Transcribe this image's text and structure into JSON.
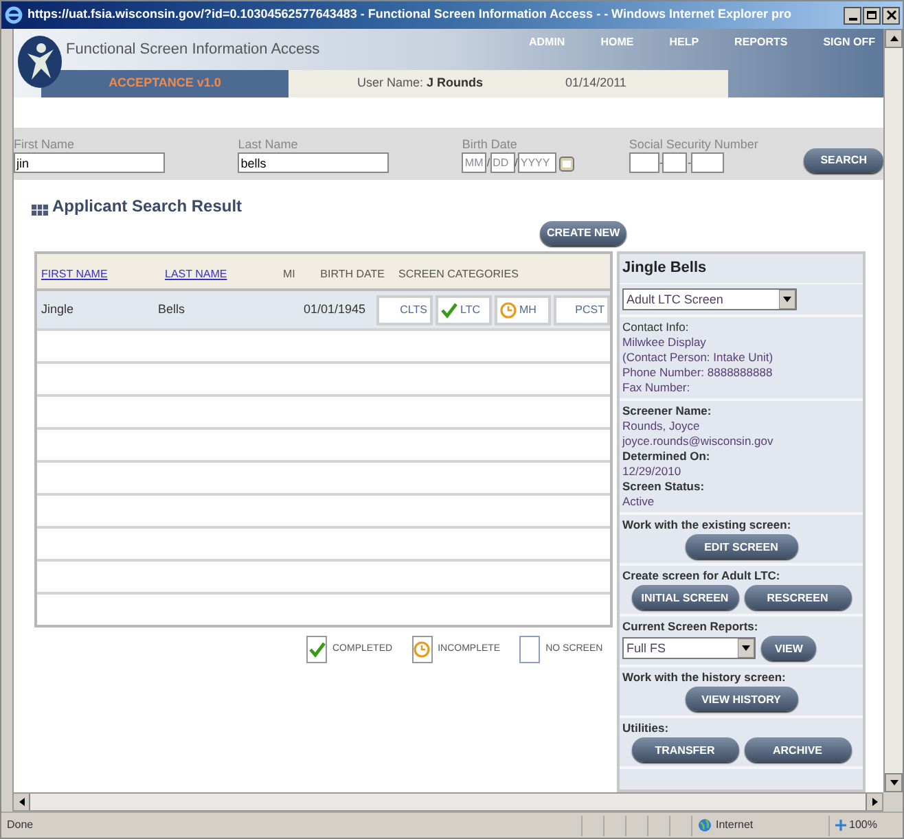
{
  "window": {
    "title": "https://uat.fsia.wisconsin.gov/?id=0.10304562577643483 - Functional Screen Information Access - - Windows Internet Explorer pro"
  },
  "header": {
    "app_title": "Functional Screen Information Access",
    "nav": [
      "ADMIN",
      "HOME",
      "HELP",
      "REPORTS",
      "SIGN OFF"
    ],
    "environment": "ACCEPTANCE v1.0",
    "user_label": "User Name:",
    "user_name": "J Rounds",
    "date": "01/14/2011"
  },
  "search": {
    "fields": [
      {
        "label": "First Name",
        "value": "jin"
      },
      {
        "label": "Last Name",
        "value": "bells"
      }
    ],
    "birth_date": {
      "label": "Birth Date",
      "placeholders": [
        "MM",
        "DD",
        "YYYY"
      ],
      "separator": "/"
    },
    "ssn": {
      "label": "Social Security Number",
      "separator": "-"
    },
    "button": "SEARCH"
  },
  "results": {
    "title": "Applicant Search Result",
    "create_button": "CREATE NEW",
    "columns": [
      {
        "label": "FIRST NAME",
        "kind": "link"
      },
      {
        "label": "LAST NAME",
        "kind": "link"
      },
      {
        "label": "MI",
        "kind": "plain"
      },
      {
        "label": "BIRTH DATE",
        "kind": "plain"
      },
      {
        "label": "SCREEN CATEGORIES",
        "kind": "plain"
      }
    ],
    "rows": [
      {
        "first_name": "Jingle",
        "last_name": "Bells",
        "birth_date": "01/01/1945",
        "selected": true,
        "categories": [
          {
            "label": "CLTS",
            "kind": "none"
          },
          {
            "label": "LTC",
            "kind": "completed"
          },
          {
            "label": "MH",
            "kind": "incomplete"
          },
          {
            "label": "PCST",
            "kind": "none"
          }
        ]
      }
    ]
  },
  "legend": [
    {
      "label": "COMPLETED",
      "kind": "completed"
    },
    {
      "label": "INCOMPLETE",
      "kind": "incomplete"
    },
    {
      "label": "NO SCREEN",
      "kind": "none"
    }
  ],
  "detail": {
    "name": "Jingle Bells",
    "screen_select": "Adult LTC Screen",
    "contact": {
      "label": "Contact Info:",
      "lines": [
        "Milwkee Display",
        "(Contact Person: Intake Unit)",
        "Phone Number: 8888888888",
        "Fax Number:"
      ]
    },
    "screener": [
      {
        "label": "Screener Name:",
        "values": [
          "Rounds, Joyce",
          "joyce.rounds@wisconsin.gov"
        ]
      },
      {
        "label": "Determined On:",
        "values": [
          "12/29/2010"
        ]
      },
      {
        "label": "Screen Status:",
        "values": [
          "Active"
        ]
      }
    ],
    "actions": [
      {
        "label": "Work with the existing screen:",
        "buttons": [
          "EDIT SCREEN"
        ]
      },
      {
        "label": "Create screen for Adult LTC:",
        "buttons": [
          "INITIAL SCREEN",
          "RESCREEN"
        ]
      },
      {
        "label": "Current Screen Reports:",
        "select": "Full FS",
        "buttons": [
          "VIEW"
        ]
      },
      {
        "label": "Work with the history screen:",
        "buttons": [
          "VIEW HISTORY"
        ]
      },
      {
        "label": "Utilities:",
        "buttons": [
          "TRANSFER",
          "ARCHIVE"
        ]
      }
    ]
  },
  "status_bar": {
    "text": "Done",
    "zone": "Internet",
    "zoom": "100%"
  }
}
